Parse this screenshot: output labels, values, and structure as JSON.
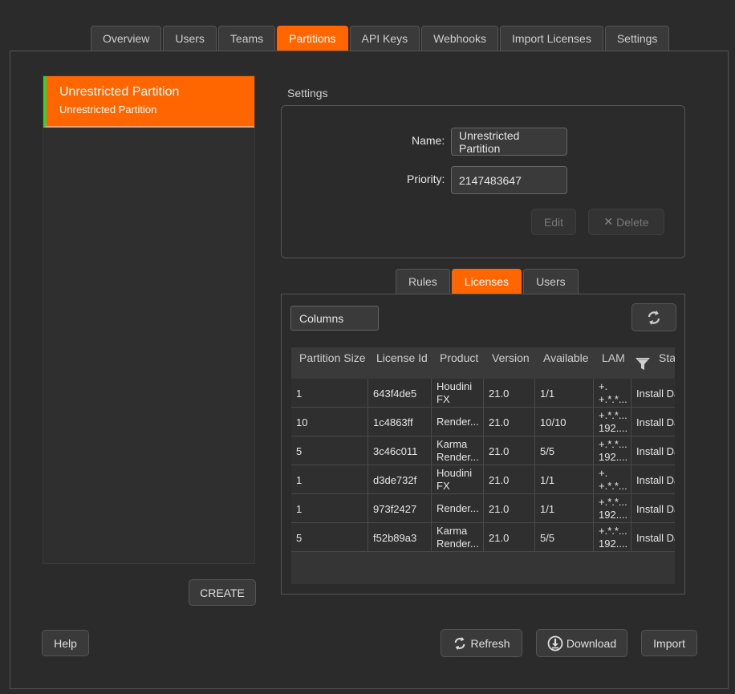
{
  "tabs": [
    {
      "label": "Overview"
    },
    {
      "label": "Users"
    },
    {
      "label": "Teams"
    },
    {
      "label": "Partitions"
    },
    {
      "label": "API Keys"
    },
    {
      "label": "Webhooks"
    },
    {
      "label": "Import Licenses"
    },
    {
      "label": "Settings"
    }
  ],
  "partitions": [
    {
      "title": "Unrestricted Partition",
      "subtitle": "Unrestricted Partition"
    }
  ],
  "create_label": "CREATE",
  "settings": {
    "heading": "Settings",
    "name_label": "Name:",
    "name_value": "Unrestricted Partition",
    "priority_label": "Priority:",
    "priority_value": "2147483647",
    "edit_label": "Edit",
    "delete_label": "Delete"
  },
  "subtabs": [
    {
      "label": "Rules"
    },
    {
      "label": "Licenses"
    },
    {
      "label": "Users"
    }
  ],
  "licenses": {
    "columns_label": "Columns",
    "headers": [
      "Partition Size",
      "License Id",
      "Product",
      "Version",
      "Available",
      "LAM",
      "Sta"
    ],
    "rows": [
      [
        "1",
        "643f4de5",
        "Houdini FX",
        "21.0",
        "1/1",
        "+.\n+.*.*...",
        "Install Da"
      ],
      [
        "10",
        "1c4863ff",
        "Render...",
        "21.0",
        "10/10",
        "+.*.*...\n192....",
        "Install Da"
      ],
      [
        "5",
        "3c46c011",
        "Karma Render...",
        "21.0",
        "5/5",
        "+.*.*...\n192....",
        "Install Da"
      ],
      [
        "1",
        "d3de732f",
        "Houdini FX",
        "21.0",
        "1/1",
        "+.\n+.*.*...",
        "Install Da"
      ],
      [
        "1",
        "973f2427",
        "Render...",
        "21.0",
        "1/1",
        "+.*.*...\n192....",
        "Install Da"
      ],
      [
        "5",
        "f52b89a3",
        "Karma Render...",
        "21.0",
        "5/5",
        "+.*.*...\n192....",
        "Install Da"
      ]
    ]
  },
  "footer": {
    "help_label": "Help",
    "refresh_label": "Refresh",
    "download_label": "Download",
    "import_label": "Import"
  },
  "colors": {
    "accent": "#ff6600",
    "selected_marker": "#3ec93e",
    "background": "#2b2b2b"
  }
}
